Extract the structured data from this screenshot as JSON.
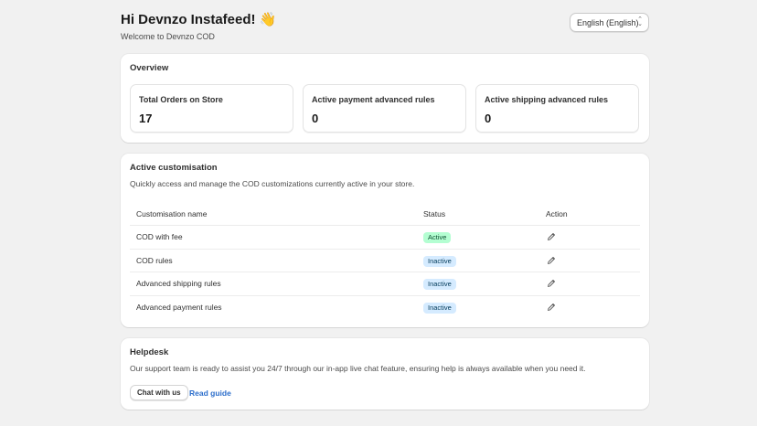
{
  "header": {
    "greeting": "Hi Devnzo Instafeed! 👋",
    "welcome": "Welcome to Devnzo COD",
    "language": "English (English)"
  },
  "overview": {
    "title": "Overview",
    "stats": [
      {
        "label": "Total Orders on Store",
        "value": "17"
      },
      {
        "label": "Active payment advanced rules",
        "value": "0"
      },
      {
        "label": "Active shipping advanced rules",
        "value": "0"
      }
    ]
  },
  "customisation": {
    "title": "Active customisation",
    "subtitle": "Quickly access and manage the COD customizations currently active in your store.",
    "columns": [
      "Customisation name",
      "Status",
      "Action"
    ],
    "rows": [
      {
        "name": "COD with fee",
        "status": "Active"
      },
      {
        "name": "COD rules",
        "status": "Inactive"
      },
      {
        "name": "Advanced shipping rules",
        "status": "Inactive"
      },
      {
        "name": "Advanced payment rules",
        "status": "Inactive"
      }
    ],
    "action_icon": "pencil-icon"
  },
  "helpdesk": {
    "title": "Helpdesk",
    "text": "Our support team is ready to assist you 24/7 through our in-app live chat feature, ensuring help is always available when you need it.",
    "chat_button": "Chat with us",
    "guide_link": "Read guide"
  },
  "colors": {
    "active_badge": "#b4fed2",
    "inactive_badge": "#d5ebff",
    "link": "#2c6ecb",
    "background": "#f1f1f1"
  }
}
